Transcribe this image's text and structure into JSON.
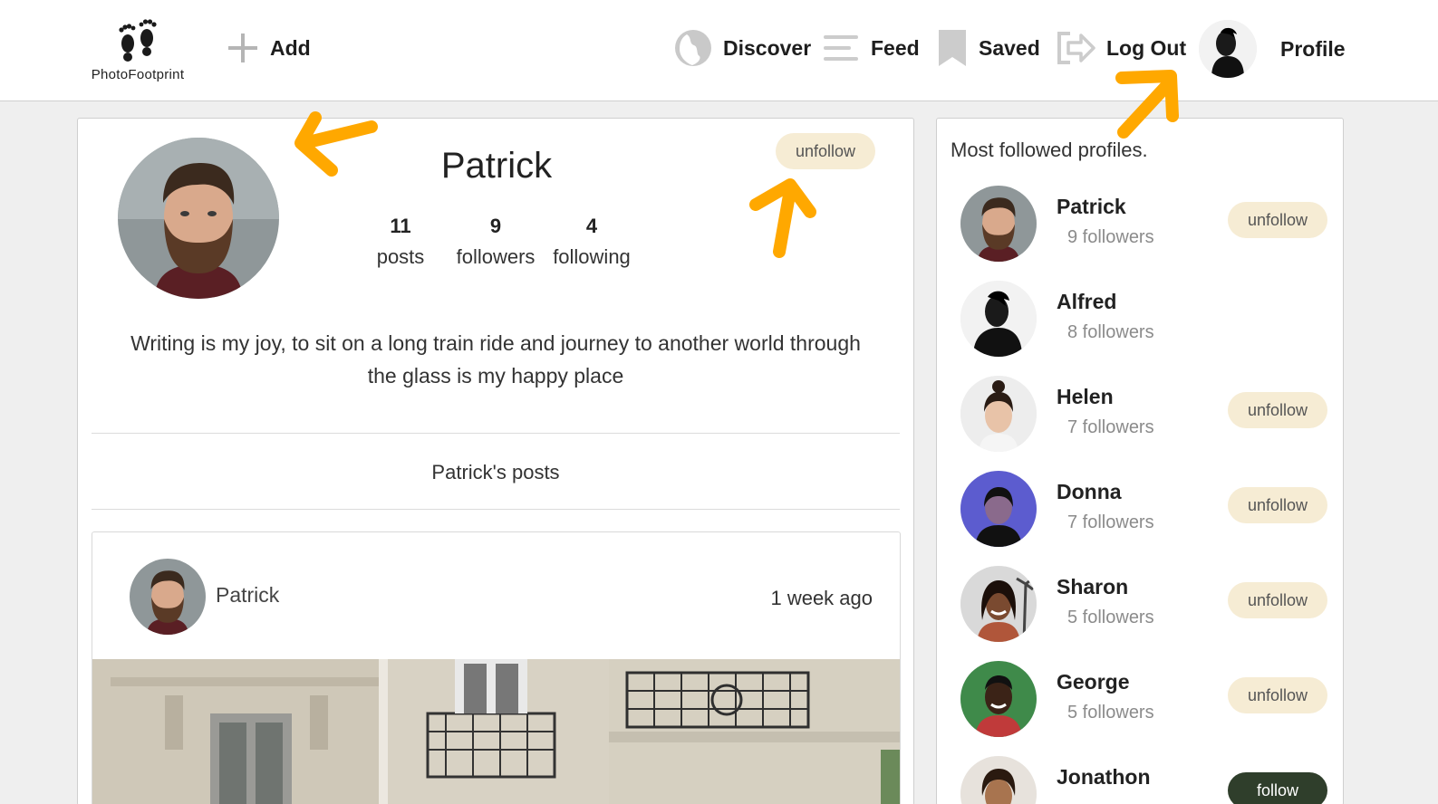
{
  "brand": {
    "name": "PhotoFootprint",
    "accent": "#f6ecd4",
    "arrow_color": "#ffa800",
    "follow_color": "#2f3e2b"
  },
  "nav": {
    "add": {
      "label": "Add",
      "icon": "plus-icon"
    },
    "discover": {
      "label": "Discover",
      "icon": "globe-icon"
    },
    "feed": {
      "label": "Feed",
      "icon": "menu-lines-icon"
    },
    "saved": {
      "label": "Saved",
      "icon": "bookmark-icon"
    },
    "logout": {
      "label": "Log Out",
      "icon": "logout-arrow-icon"
    },
    "profile": {
      "label": "Profile",
      "icon": "avatar"
    }
  },
  "profile": {
    "name": "Patrick",
    "action_label": "unfollow",
    "stats": [
      {
        "value": "11",
        "label": "posts"
      },
      {
        "value": "9",
        "label": "followers"
      },
      {
        "value": "4",
        "label": "following"
      }
    ],
    "bio": "Writing is my joy, to sit on a long train ride and journey to another world through the glass is my happy place",
    "posts_heading": "Patrick's posts"
  },
  "post": {
    "author": "Patrick",
    "time": "1 week ago"
  },
  "sidebar": {
    "title": "Most followed profiles.",
    "items": [
      {
        "name": "Patrick",
        "followers": "9 followers",
        "action": "unfollow"
      },
      {
        "name": "Alfred",
        "followers": "8 followers",
        "action": ""
      },
      {
        "name": "Helen",
        "followers": "7 followers",
        "action": "unfollow"
      },
      {
        "name": "Donna",
        "followers": "7 followers",
        "action": "unfollow"
      },
      {
        "name": "Sharon",
        "followers": "5 followers",
        "action": "unfollow"
      },
      {
        "name": "George",
        "followers": "5 followers",
        "action": "unfollow"
      },
      {
        "name": "Jonathon",
        "followers": "",
        "action": "follow"
      }
    ]
  }
}
